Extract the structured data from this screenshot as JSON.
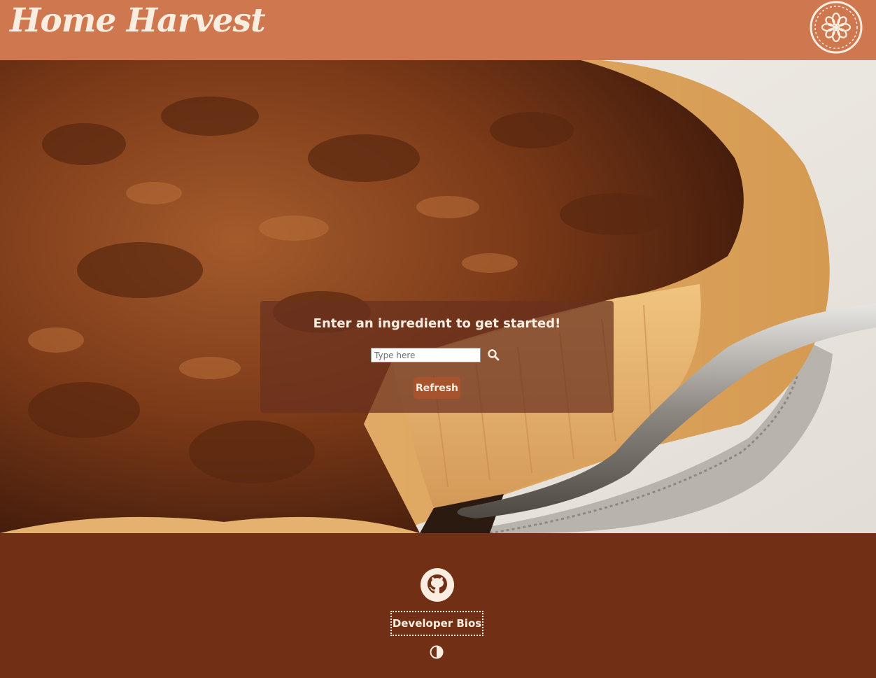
{
  "brand": {
    "name": "Home Harvest",
    "logo_icon": "flower-badge-icon"
  },
  "colors": {
    "header_bg": "#cf774e",
    "footer_bg": "#713016",
    "panel_bg": "rgba(105,48,30,0.72)",
    "button_bg": "#a7532d",
    "text_light": "#fbeee0"
  },
  "hero": {
    "image": "pecan-pie-slice-photo"
  },
  "search": {
    "title": "Enter an ingredient to get started!",
    "placeholder": "Type here",
    "value": "",
    "search_icon": "search-icon",
    "refresh_label": "Refresh"
  },
  "footer": {
    "github_icon": "github-icon",
    "bios_label": "Developer Bios",
    "contrast_icon": "contrast-icon"
  }
}
